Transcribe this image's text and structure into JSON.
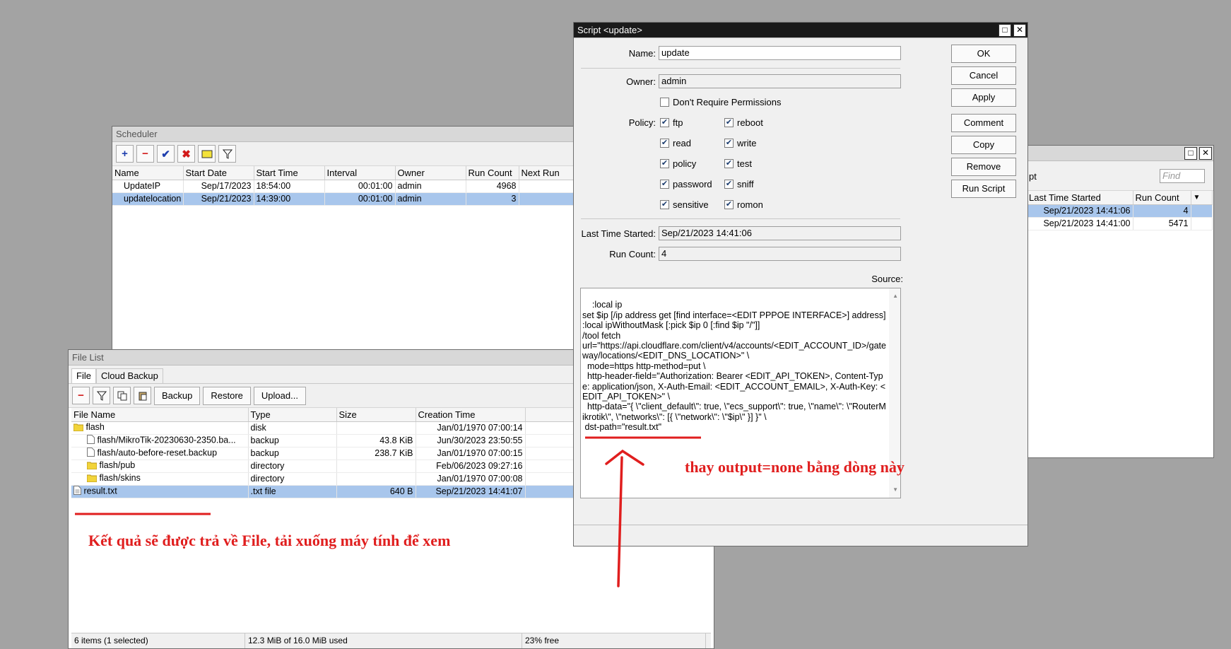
{
  "scheduler": {
    "title": "Scheduler",
    "columns": [
      "Name",
      "Start Date",
      "Start Time",
      "Interval",
      "Owner",
      "Run Count",
      "Next Run"
    ],
    "rows": [
      {
        "name": "UpdateIP",
        "start_date": "Sep/17/2023",
        "start_time": "18:54:00",
        "interval": "00:01:00",
        "owner": "admin",
        "run_count": "4968",
        "next_run": ""
      },
      {
        "name": "updatelocation",
        "start_date": "Sep/21/2023",
        "start_time": "14:39:00",
        "interval": "00:01:00",
        "owner": "admin",
        "run_count": "3",
        "next_run": ""
      }
    ]
  },
  "file_list": {
    "title": "File List",
    "tabs": [
      "File",
      "Cloud Backup"
    ],
    "toolbar": {
      "backup": "Backup",
      "restore": "Restore",
      "upload": "Upload..."
    },
    "columns": [
      "File Name",
      "Type",
      "Size",
      "Creation Time"
    ],
    "rows": [
      {
        "name": "flash",
        "type": "disk",
        "size": "",
        "created": "Jan/01/1970 07:00:14"
      },
      {
        "name": "flash/MikroTik-20230630-2350.ba...",
        "type": "backup",
        "size": "43.8 KiB",
        "created": "Jun/30/2023 23:50:55"
      },
      {
        "name": "flash/auto-before-reset.backup",
        "type": "backup",
        "size": "238.7 KiB",
        "created": "Jan/01/1970 07:00:15"
      },
      {
        "name": "flash/pub",
        "type": "directory",
        "size": "",
        "created": "Feb/06/2023 09:27:16"
      },
      {
        "name": "flash/skins",
        "type": "directory",
        "size": "",
        "created": "Jan/01/1970 07:00:08"
      },
      {
        "name": "result.txt",
        "type": ".txt file",
        "size": "640 B",
        "created": "Sep/21/2023 14:41:07"
      }
    ],
    "status": {
      "items": "6 items (1 selected)",
      "used": "12.3 MiB of 16.0 MiB used",
      "free": "23% free"
    }
  },
  "script_dialog": {
    "title": "Script <update>",
    "name_label": "Name:",
    "name_value": "update",
    "owner_label": "Owner:",
    "owner_value": "admin",
    "dont_require_label": "Don't Require Permissions",
    "policy_label": "Policy:",
    "policies": {
      "ftp": "ftp",
      "reboot": "reboot",
      "read": "read",
      "write": "write",
      "policy": "policy",
      "test": "test",
      "password": "password",
      "sniff": "sniff",
      "sensitive": "sensitive",
      "romon": "romon"
    },
    "last_time_started_label": "Last Time Started:",
    "last_time_started_value": "Sep/21/2023 14:41:06",
    "run_count_label": "Run Count:",
    "run_count_value": "4",
    "source_label": "Source:",
    "source": ":local ip\nset $ip [/ip address get [find interface=<EDIT PPPOE INTERFACE>] address]\n:local ipWithoutMask [:pick $ip 0 [:find $ip \"/\"]]\n/tool fetch\nurl=\"https://api.cloudflare.com/client/v4/accounts/<EDIT_ACCOUNT_ID>/gateway/locations/<EDIT_DNS_LOCATION>\" \\\n  mode=https http-method=put \\\n  http-header-field=\"Authorization: Bearer <EDIT_API_TOKEN>, Content-Type: application/json, X-Auth-Email: <EDIT_ACCOUNT_EMAIL>, X-Auth-Key: <EDIT_API_TOKEN>\" \\\n  http-data=\"{ \\\"client_default\\\": true, \\\"ecs_support\\\": true, \\\"name\\\": \\\"RouterMikrotik\\\", \\\"networks\\\": [{ \\\"network\\\": \\\"$ip\\\" }] }\" \\\n dst-path=\"result.txt\"",
    "buttons": {
      "ok": "OK",
      "cancel": "Cancel",
      "apply": "Apply",
      "comment": "Comment",
      "copy": "Copy",
      "remove": "Remove",
      "run_script": "Run Script"
    }
  },
  "jobs_window": {
    "partial_tab": "pt",
    "find_placeholder": "Find",
    "columns": [
      "Last Time Started",
      "Run Count"
    ],
    "rows": [
      {
        "last_started": "Sep/21/2023 14:41:06",
        "run_count": "4"
      },
      {
        "last_started": "Sep/21/2023 14:41:00",
        "run_count": "5471"
      }
    ]
  },
  "annotations": {
    "output_note": "thay output=none bằng dòng này",
    "file_note": "Kết quả sẽ được trả về File, tải xuống máy tính để xem"
  },
  "colors": {
    "annotation": "#e01e1e",
    "selection": "#a8c6ec",
    "desktop": "#a3a3a3"
  }
}
